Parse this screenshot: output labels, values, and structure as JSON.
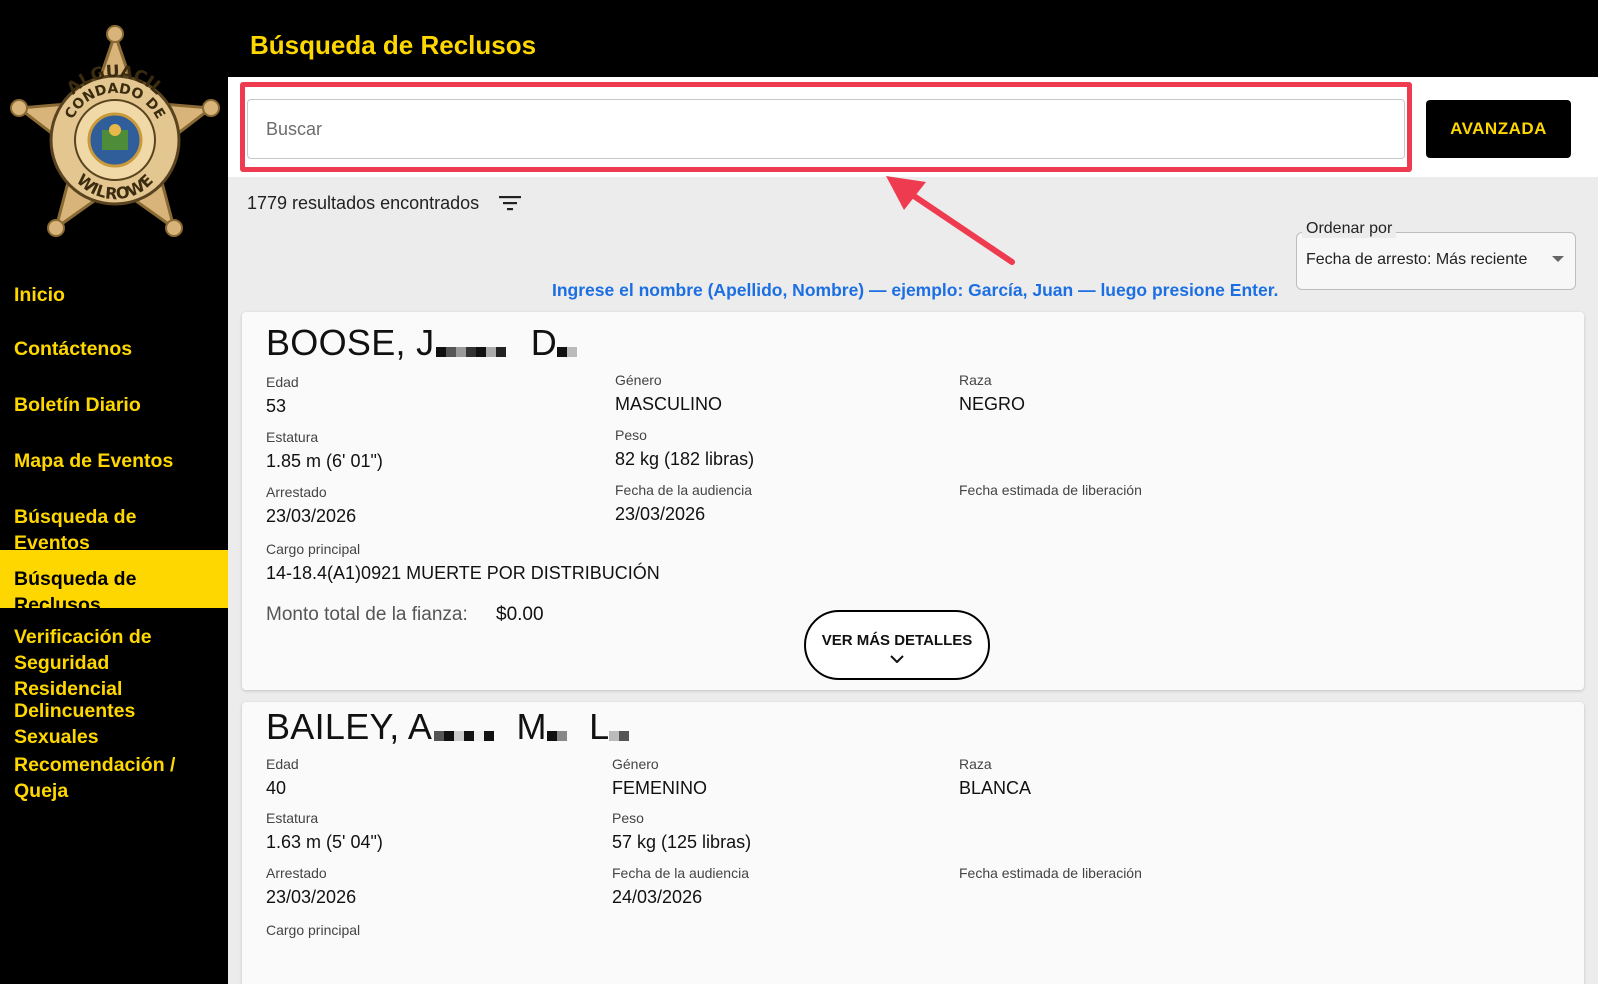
{
  "page": {
    "title": "Búsqueda de Reclusos"
  },
  "badge": {
    "top_text": "ALGUACIL",
    "middle_text": "CONDADO DE",
    "bottom_text": "WILROWE"
  },
  "sidebar": {
    "items": [
      {
        "label": "Inicio"
      },
      {
        "label": "Contáctenos"
      },
      {
        "label": "Boletín Diario"
      },
      {
        "label": "Mapa de Eventos"
      },
      {
        "label": "Búsqueda de Eventos"
      },
      {
        "label": "Búsqueda de Reclusos",
        "active": true
      },
      {
        "label": "Verificación de Seguridad Residencial"
      },
      {
        "label": "Delincuentes Sexuales"
      },
      {
        "label": "Recomendación / Queja"
      }
    ]
  },
  "search": {
    "placeholder": "Buscar",
    "advanced_label": "AVANZADA"
  },
  "results": {
    "count_text": "1779 resultados encontrados"
  },
  "sort": {
    "label": "Ordenar por",
    "value": "Fecha de arresto: Más reciente"
  },
  "hint": "Ingrese el nombre (Apellido, Nombre) — ejemplo: García, Juan — luego presione Enter.",
  "labels": {
    "age": "Edad",
    "gender": "Género",
    "race": "Raza",
    "height": "Estatura",
    "weight": "Peso",
    "arrested": "Arrestado",
    "hearing": "Fecha de la audiencia",
    "release": "Fecha estimada de liberación",
    "charge": "Cargo principal",
    "bond": "Monto total de la fianza:",
    "details": "VER MÁS DETALLES"
  },
  "inmates": [
    {
      "last_name": "BOOSE, J",
      "middle_initial": "D",
      "age": "53",
      "gender": "MASCULINO",
      "race": "NEGRO",
      "height": "1.85 m (6' 01\")",
      "weight": "82 kg (182 libras)",
      "arrested": "23/03/2026",
      "hearing": "23/03/2026",
      "charge": "14-18.4(A1)0921 MUERTE POR DISTRIBUCIÓN",
      "bond": "$0.00"
    },
    {
      "last_name": "BAILEY, A",
      "middle_initial": "M",
      "suffix_initial": "L",
      "age": "40",
      "gender": "FEMENINO",
      "race": "BLANCA",
      "height": "1.63 m (5' 04\")",
      "weight": "57 kg (125 libras)",
      "arrested": "23/03/2026",
      "hearing": "24/03/2026"
    }
  ],
  "colors": {
    "accent_yellow": "#ffd700",
    "highlight_red": "#ef3b4f",
    "hint_blue": "#1c6fe3"
  }
}
